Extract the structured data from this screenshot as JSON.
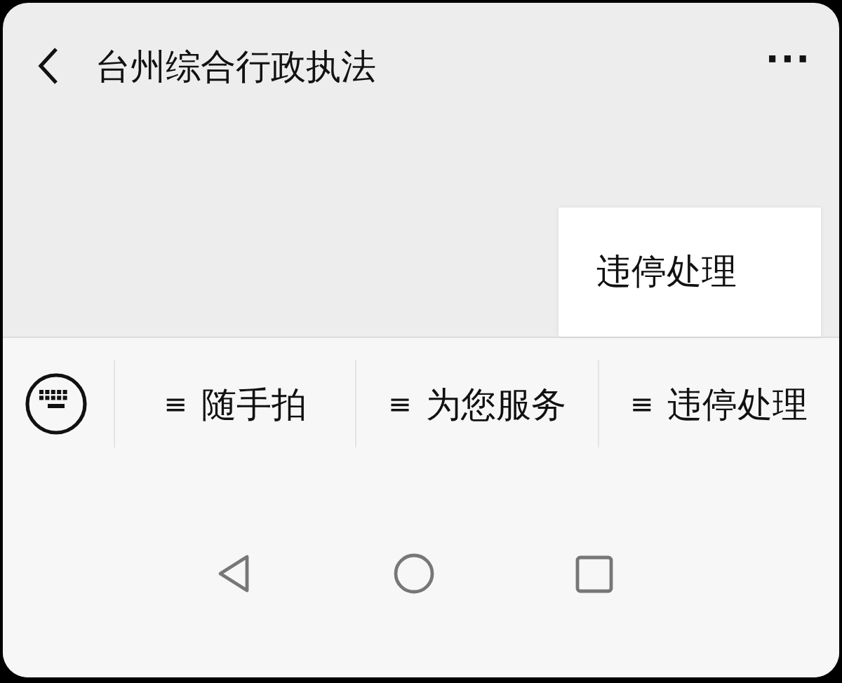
{
  "header": {
    "title": "台州综合行政执法",
    "more": "···"
  },
  "submenu": [
    {
      "label": "违停处理"
    }
  ],
  "menu": [
    {
      "icon": "≡",
      "label": "随手拍"
    },
    {
      "icon": "≡",
      "label": "为您服务"
    },
    {
      "icon": "≡",
      "label": "违停处理"
    }
  ]
}
